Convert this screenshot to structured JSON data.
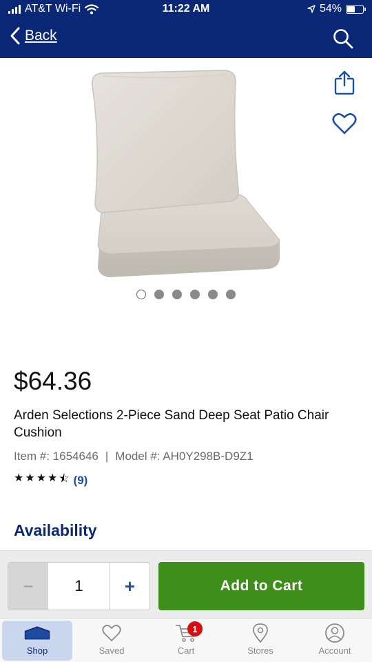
{
  "status_bar": {
    "carrier": "AT&T Wi-Fi",
    "time": "11:22 AM",
    "battery": "54%",
    "battery_level": 0.54
  },
  "nav": {
    "back_label": "Back",
    "search_icon": "search-icon",
    "back_icon": "chevron-left-icon"
  },
  "gallery": {
    "image_count": 6,
    "active_index": 0,
    "share_icon": "share-icon",
    "favorite_icon": "heart-icon"
  },
  "product": {
    "price": "$64.36",
    "title": "Arden Selections 2-Piece Sand Deep Seat Patio Chair Cushion",
    "item_number": "Item #: 1654646",
    "separator": "|",
    "model_number": "Model #: AH0Y298B-D9Z1",
    "rating": 4.5,
    "review_count": "(9)"
  },
  "availability": {
    "heading": "Availability"
  },
  "cart_controls": {
    "minus": "−",
    "quantity": "1",
    "plus": "+",
    "add_to_cart": "Add to Cart"
  },
  "tab_bar": {
    "tabs": [
      {
        "label": "Shop",
        "icon": "shop-icon",
        "active": true
      },
      {
        "label": "Saved",
        "icon": "heart-icon"
      },
      {
        "label": "Cart",
        "icon": "cart-icon",
        "badge": "1"
      },
      {
        "label": "Stores",
        "icon": "location-pin-icon"
      },
      {
        "label": "Account",
        "icon": "account-icon"
      }
    ]
  },
  "colors": {
    "brand_navy": "#0a2875",
    "add_to_cart_green": "#3e8e1c",
    "link_blue": "#1b4fa8",
    "badge_red": "#d50f0f"
  }
}
